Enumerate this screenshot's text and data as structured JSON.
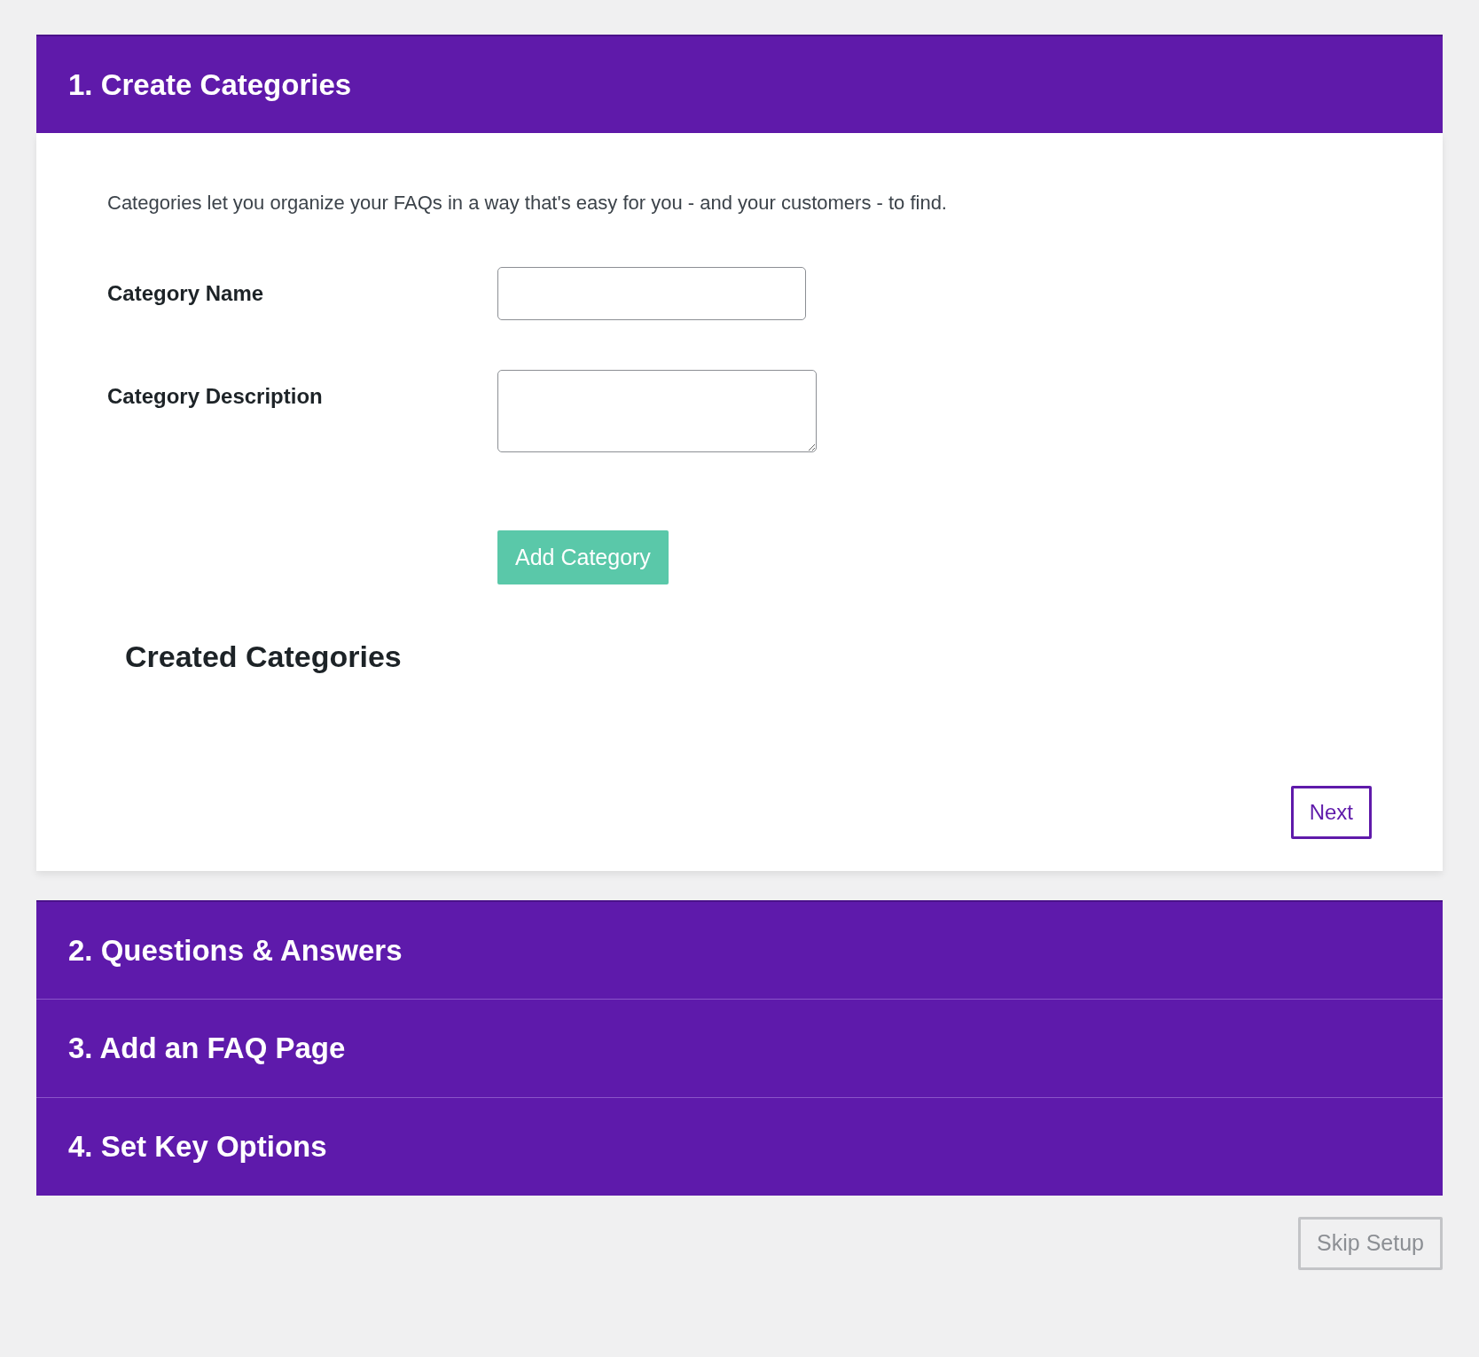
{
  "steps": [
    {
      "title": "1. Create Categories",
      "expanded": true
    },
    {
      "title": "2. Questions & Answers",
      "expanded": false
    },
    {
      "title": "3. Add an FAQ Page",
      "expanded": false
    },
    {
      "title": "4. Set Key Options",
      "expanded": false
    }
  ],
  "intro": "Categories let you organize your FAQs in a way that's easy for you - and your customers - to find.",
  "fields": [
    {
      "kind": "input",
      "label": "Category Name"
    },
    {
      "kind": "textarea",
      "label": "Category Description"
    }
  ],
  "add_button": "Add Category",
  "created_heading": "Created Categories",
  "next_button": "Next",
  "skip_button": "Skip Setup"
}
